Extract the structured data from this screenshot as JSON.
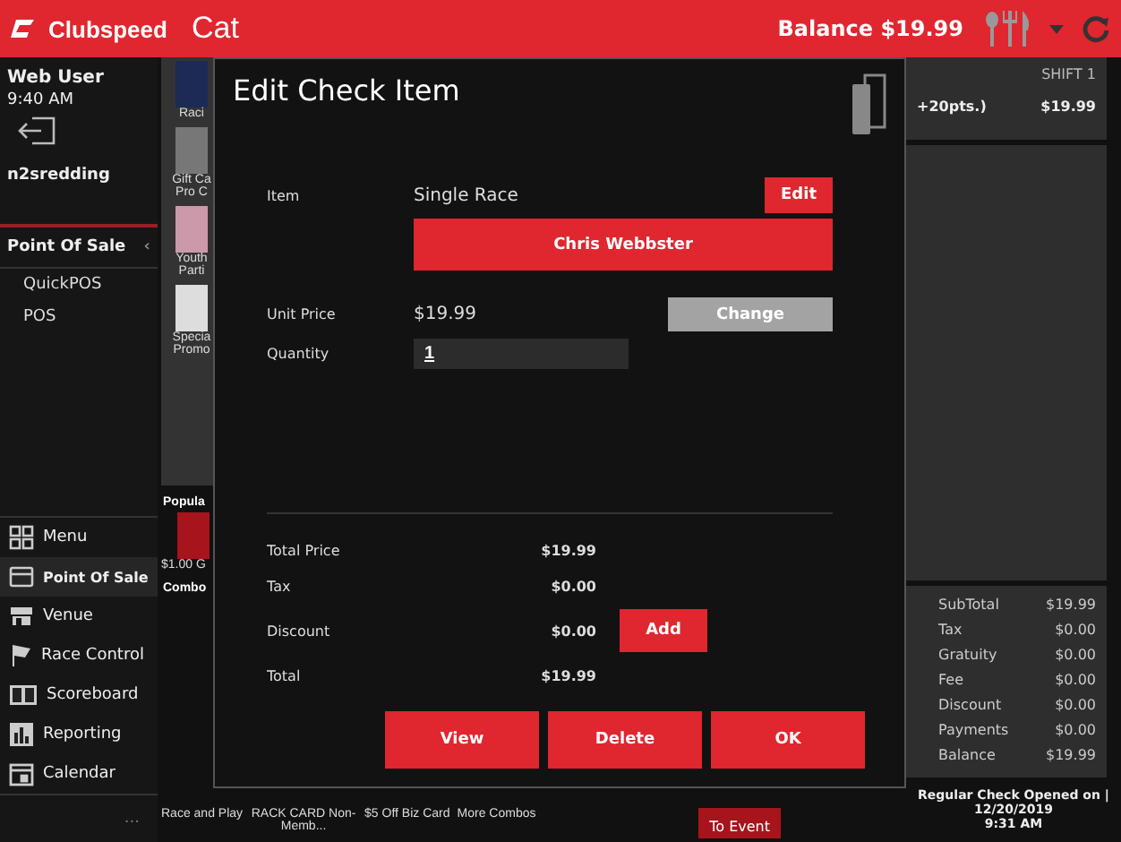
{
  "header": {
    "brand": "Clubspeed",
    "title": "Cat",
    "balance": "Balance $19.99"
  },
  "sidebar": {
    "user": "Web User",
    "time": "9:40 AM",
    "location": "n2sredding",
    "section": {
      "label": "Point Of Sale",
      "toggle": "‹",
      "items": [
        "QuickPOS",
        "POS"
      ]
    },
    "nav": [
      {
        "label": "Menu",
        "selected": false
      },
      {
        "label": "Point Of Sale",
        "selected": true
      },
      {
        "label": "Venue",
        "selected": false
      },
      {
        "label": "Race Control",
        "selected": false
      },
      {
        "label": "Scoreboard",
        "selected": false
      },
      {
        "label": "Reporting",
        "selected": false
      },
      {
        "label": "Calendar",
        "selected": false
      }
    ],
    "more": "..."
  },
  "catalog": {
    "tiles": [
      {
        "lines": [
          "Raci"
        ]
      },
      {
        "lines": [
          "Gift Ca",
          "Pro C"
        ]
      },
      {
        "lines": [
          "Youth",
          "Parti"
        ]
      },
      {
        "lines": [
          "Specia",
          "Promo"
        ]
      }
    ],
    "popular": {
      "heading": "Popula",
      "tiles": [
        "$1.00 G"
      ]
    },
    "combos": {
      "heading": "Combo",
      "tiles": [
        "Race and Play",
        "RACK CARD Non-Memb...",
        "$5 Off Biz Card",
        "More Combos"
      ]
    },
    "event_button": "To Event"
  },
  "check": {
    "shift": "SHIFT 1",
    "line": {
      "desc": "+20pts.)",
      "price": "$19.99"
    },
    "totals": [
      {
        "label": "SubTotal",
        "value": "$19.99"
      },
      {
        "label": "Tax",
        "value": "$0.00"
      },
      {
        "label": "Gratuity",
        "value": "$0.00"
      },
      {
        "label": "Fee",
        "value": "$0.00"
      },
      {
        "label": "Discount",
        "value": "$0.00"
      },
      {
        "label": "Payments",
        "value": "$0.00"
      },
      {
        "label": "Balance",
        "value": "$19.99"
      }
    ],
    "footer": [
      "Regular Check Opened on  |  12/20/2019",
      "9:31 AM"
    ]
  },
  "modal": {
    "title": "Edit Check Item",
    "item": {
      "label": "Item",
      "value": "Single Race",
      "button": "Edit"
    },
    "customer": "Chris Webbster",
    "unit_price": {
      "label": "Unit Price",
      "value": "$19.99",
      "button": "Change"
    },
    "quantity": {
      "label": "Quantity",
      "value": "1"
    },
    "totals": [
      {
        "label": "Total Price",
        "value": "$19.99"
      },
      {
        "label": "Tax",
        "value": "$0.00"
      },
      {
        "label": "Discount",
        "value": "$0.00",
        "button": "Add"
      },
      {
        "label": "Total",
        "value": "$19.99"
      }
    ],
    "actions": [
      "View",
      "Delete",
      "OK"
    ]
  }
}
